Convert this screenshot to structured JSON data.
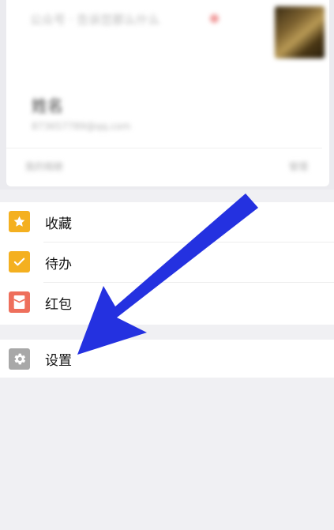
{
  "profile_card": {
    "source_text": "公众号 · 告诉您那么什么",
    "name": "姓名",
    "email": "873657789@qq.com",
    "footer_left": "我的相册",
    "footer_right": "管理"
  },
  "menu": {
    "favorites_label": "收藏",
    "todo_label": "待办",
    "red_packet_label": "红包",
    "settings_label": "设置"
  },
  "colors": {
    "favorites_icon": "#f4b020",
    "todo_icon": "#f4b020",
    "red_packet_icon": "#ee6f5c",
    "settings_icon": "#a8a8a8",
    "arrow": "#2431e0"
  },
  "icons": {
    "favorites": "star-icon",
    "todo": "check-icon",
    "red_packet": "red-packet-icon",
    "settings": "gear-icon",
    "annotation": "arrow-icon"
  }
}
